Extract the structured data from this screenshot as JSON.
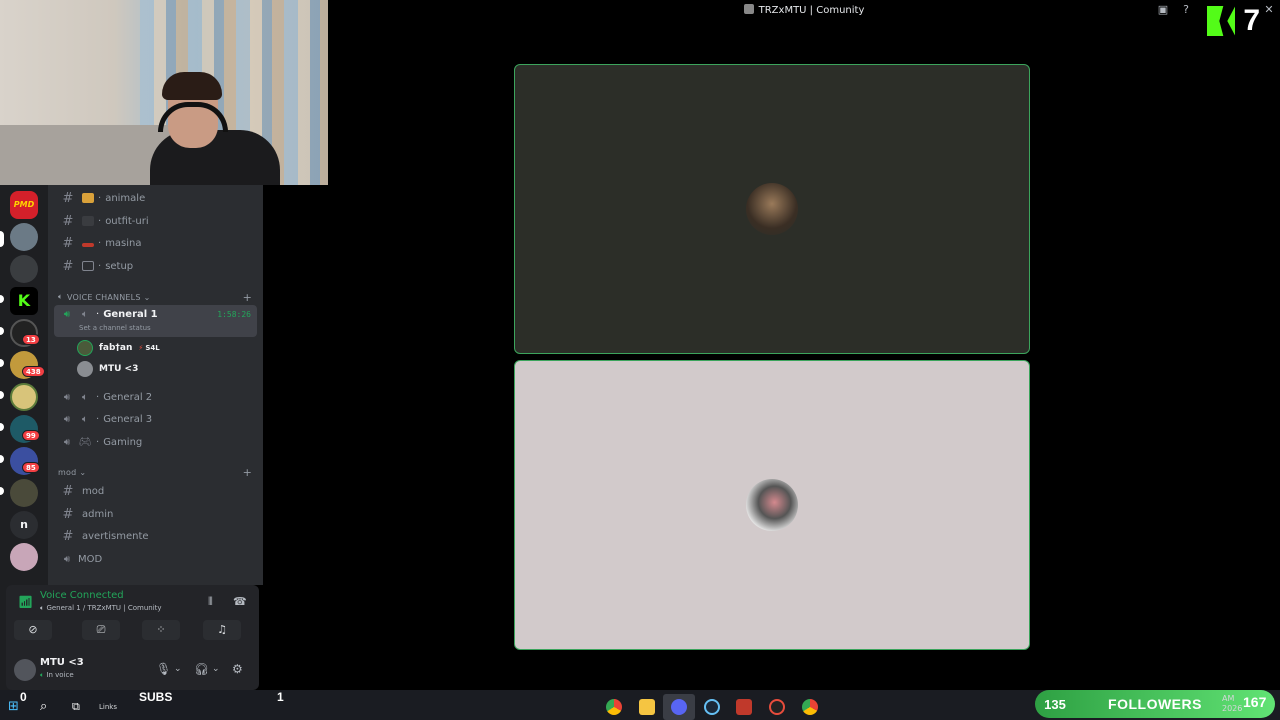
{
  "window": {
    "title": "TRZxMTU | Comunity"
  },
  "overlay": {
    "kick_count": "7"
  },
  "rail": {
    "badges": [
      "13",
      "438",
      "99",
      "85"
    ],
    "letter_server": "n",
    "pmd_label": "PMD"
  },
  "channels": {
    "text": [
      {
        "name": "animale"
      },
      {
        "name": "outfit-uri"
      },
      {
        "name": "masina"
      },
      {
        "name": "setup"
      }
    ],
    "voice_category": "VOICE CHANNELS",
    "active_voice": {
      "name": "General 1",
      "time": "1:58:26",
      "status_placeholder": "Set a channel status"
    },
    "voice_users": [
      {
        "name": "fab†an",
        "tag": "S4L"
      },
      {
        "name": "MTU <3"
      }
    ],
    "other_voice": [
      {
        "name": "General 2"
      },
      {
        "name": "General 3"
      },
      {
        "name": "Gaming"
      }
    ],
    "mod_category": "mod",
    "mod_channels": [
      {
        "name": "mod"
      },
      {
        "name": "admin"
      },
      {
        "name": "avertismente"
      }
    ],
    "mod_voice": "MOD"
  },
  "voice_panel": {
    "status": "Voice Connected",
    "location": "General 1 / TRZxMTU | Comunity"
  },
  "user_panel": {
    "name": "MTU <3",
    "status": "In voice"
  },
  "stream_overlay": {
    "subs_count": "0",
    "subs_label": "SUBS",
    "subs_goal": "1",
    "followers_count": "135",
    "followers_label": "FOLLOWERS",
    "followers_goal": "167"
  },
  "taskbar": {
    "links_label": "Links",
    "clock_ampm": "AM",
    "clock_year": "2026"
  },
  "colors": {
    "accent_green": "#3ca45c",
    "discord_bg": "#2b2d31",
    "kick_green": "#53fc18"
  }
}
